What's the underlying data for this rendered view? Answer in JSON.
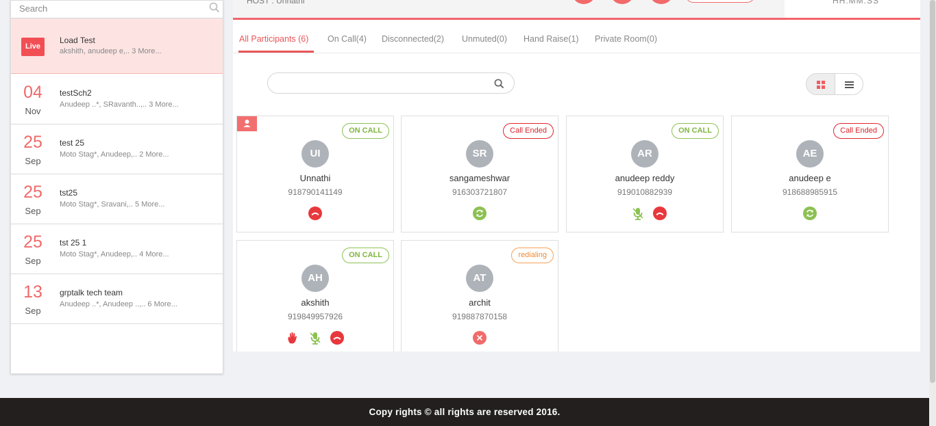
{
  "sidebar": {
    "search_placeholder": "Search",
    "sessions": [
      {
        "badge": "Live",
        "title": "Load Test",
        "subtitle": "akshith, anudeep e,.. 3 More..."
      },
      {
        "day": "04",
        "month": "Nov",
        "title": "testSch2",
        "subtitle": "Anudeep ..*, SRavanth..,.. 3 More..."
      },
      {
        "day": "25",
        "month": "Sep",
        "title": "test 25",
        "subtitle": "Moto Stag*, Anudeep,.. 2 More..."
      },
      {
        "day": "25",
        "month": "Sep",
        "title": "tst25",
        "subtitle": "Moto Stag*, Sravani,.. 5 More..."
      },
      {
        "day": "25",
        "month": "Sep",
        "title": "tst 25 1",
        "subtitle": "Moto Stag*, Anudeep,.. 4 More..."
      },
      {
        "day": "13",
        "month": "Sep",
        "title": "grptalk tech team",
        "subtitle": "Anudeep ..*, Anudeep ..,.. 6 More..."
      }
    ]
  },
  "header": {
    "host_text": "HOST : Unnathi",
    "timer_text": "HH:MM:SS"
  },
  "tabs": [
    {
      "label": "All Participants (6)"
    },
    {
      "label": "On Call(4)"
    },
    {
      "label": "Disconnected(2)"
    },
    {
      "label": "Unmuted(0)"
    },
    {
      "label": "Hand Raise(1)"
    },
    {
      "label": "Private Room(0)"
    }
  ],
  "participant_search": {
    "placeholder": ""
  },
  "participants": [
    {
      "initials": "UI",
      "name": "Unnathi",
      "phone": "918790141149",
      "status": "ON CALL",
      "host": true,
      "icons": [
        "hangup-icon"
      ]
    },
    {
      "initials": "SR",
      "name": "sangameshwar",
      "phone": "916303721807",
      "status": "Call Ended",
      "icons": [
        "redial-icon"
      ]
    },
    {
      "initials": "AR",
      "name": "anudeep reddy",
      "phone": "919010882939",
      "status": "ON CALL",
      "icons": [
        "mic-muted-icon",
        "hangup-icon"
      ]
    },
    {
      "initials": "AE",
      "name": "anudeep e",
      "phone": "918688985915",
      "status": "Call Ended",
      "icons": [
        "redial-icon"
      ]
    },
    {
      "initials": "AH",
      "name": "akshith",
      "phone": "919849957926",
      "status": "ON CALL",
      "icons": [
        "hand-raise-icon",
        "mic-muted-icon",
        "hangup-icon"
      ]
    },
    {
      "initials": "AT",
      "name": "archit",
      "phone": "919887870158",
      "status": "redialing",
      "icons": [
        "cancel-icon"
      ]
    }
  ],
  "colors": {
    "accent": "#ea5558",
    "on_call": "#7fb640",
    "call_ended": "#d9232a",
    "redialing": "#f08a30",
    "footer_bg": "#221f1e"
  },
  "footer": {
    "text": "Copy rights © all rights are reserved 2016."
  }
}
